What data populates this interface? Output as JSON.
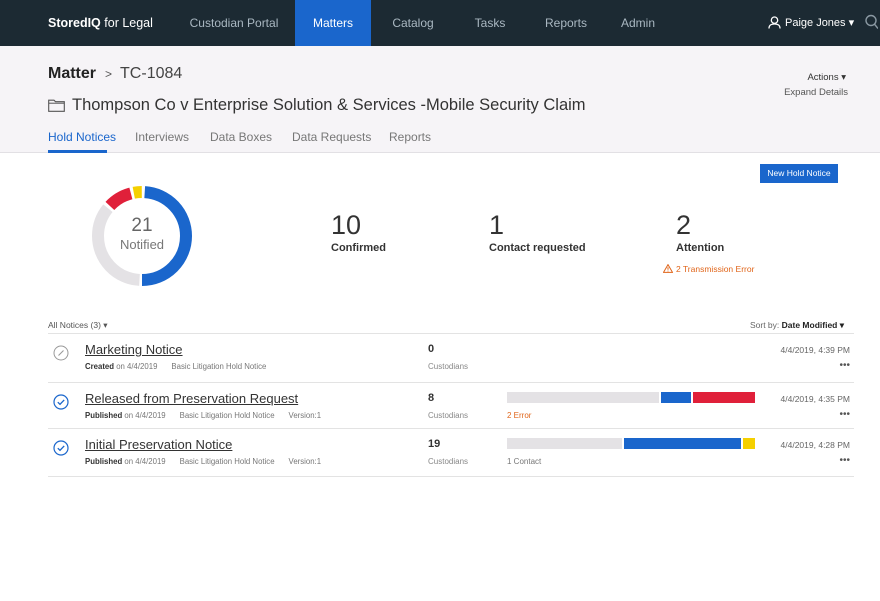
{
  "nav": {
    "brand_bold": "StoredIQ",
    "brand_rest": " for Legal",
    "items": [
      "Custodian Portal",
      "Matters",
      "Catalog",
      "Tasks",
      "Reports",
      "Admin"
    ],
    "active": "Matters",
    "user": "Paige Jones ▾"
  },
  "header": {
    "breadcrumb_root": "Matter",
    "breadcrumb_sep": ">",
    "matter_id": "TC-1084",
    "actions": "Actions ▾",
    "expand": "Expand Details",
    "title": "Thompson Co v Enterprise Solution & Services -Mobile Security Claim",
    "tabs": [
      "Hold Notices",
      "Interviews",
      "Data Boxes",
      "Data Requests",
      "Reports"
    ],
    "active_tab": "Hold Notices"
  },
  "summary": {
    "new_button": "New Hold Notice",
    "notified_count": "21",
    "notified_label": "Notified",
    "confirmed_count": "10",
    "confirmed_label": "Confirmed",
    "contact_count": "1",
    "contact_label": "Contact requested",
    "attention_count": "2",
    "attention_label": "Attention",
    "attention_warning": "2 Transmission Error",
    "donut_segments": [
      {
        "status": "confirmed",
        "value": 0.5,
        "color": "#1a66cc"
      },
      {
        "status": "contact",
        "value": 0.04,
        "color": "#f5d000"
      },
      {
        "status": "error",
        "value": 0.1,
        "color": "#e0203a"
      },
      {
        "status": "pending",
        "value": 0.36,
        "color": "#e4e2e5"
      }
    ]
  },
  "list": {
    "filter": "All Notices (3) ▾",
    "sort_label": "Sort by:",
    "sort_value": "Date Modified ▾",
    "rows": [
      {
        "status_icon": "edit-circle-icon",
        "title": "Marketing Notice",
        "meta_verb": "Created",
        "meta_date": " on 4/4/2019",
        "template": "Basic Litigation Hold Notice",
        "version": "",
        "count": "0",
        "count_label": "Custodians",
        "bar_note": "",
        "date": "4/4/2019, 4:39 PM",
        "more": "•••"
      },
      {
        "status_icon": "check-circle-icon",
        "title": "Released from Preservation Request",
        "meta_verb": "Published",
        "meta_date": " on 4/4/2019",
        "template": "Basic Litigation Hold Notice",
        "version": "Version:1",
        "count": "8",
        "count_label": "Custodians",
        "bar_note": "2 Error",
        "bar_note_color": "#e0651a",
        "bar_segments": [
          {
            "status": "pending",
            "value": 0.62,
            "color": "#e4e2e5"
          },
          {
            "status": "confirmed",
            "value": 0.13,
            "color": "#1a66cc"
          },
          {
            "status": "error",
            "value": 0.25,
            "color": "#e0203a"
          }
        ],
        "date": "4/4/2019, 4:35 PM",
        "more": "•••"
      },
      {
        "status_icon": "check-circle-icon",
        "title": "Initial Preservation Notice",
        "meta_verb": "Published",
        "meta_date": " on 4/4/2019",
        "template": "Basic Litigation Hold Notice",
        "version": "Version:1",
        "count": "19",
        "count_label": "Custodians",
        "bar_note": "1 Contact",
        "bar_note_color": "#777777",
        "bar_segments": [
          {
            "status": "pending",
            "value": 0.47,
            "color": "#e4e2e5"
          },
          {
            "status": "confirmed",
            "value": 0.48,
            "color": "#1a66cc"
          },
          {
            "status": "contact",
            "value": 0.05,
            "color": "#f5d000"
          }
        ],
        "date": "4/4/2019, 4:28 PM",
        "more": "•••"
      }
    ]
  }
}
